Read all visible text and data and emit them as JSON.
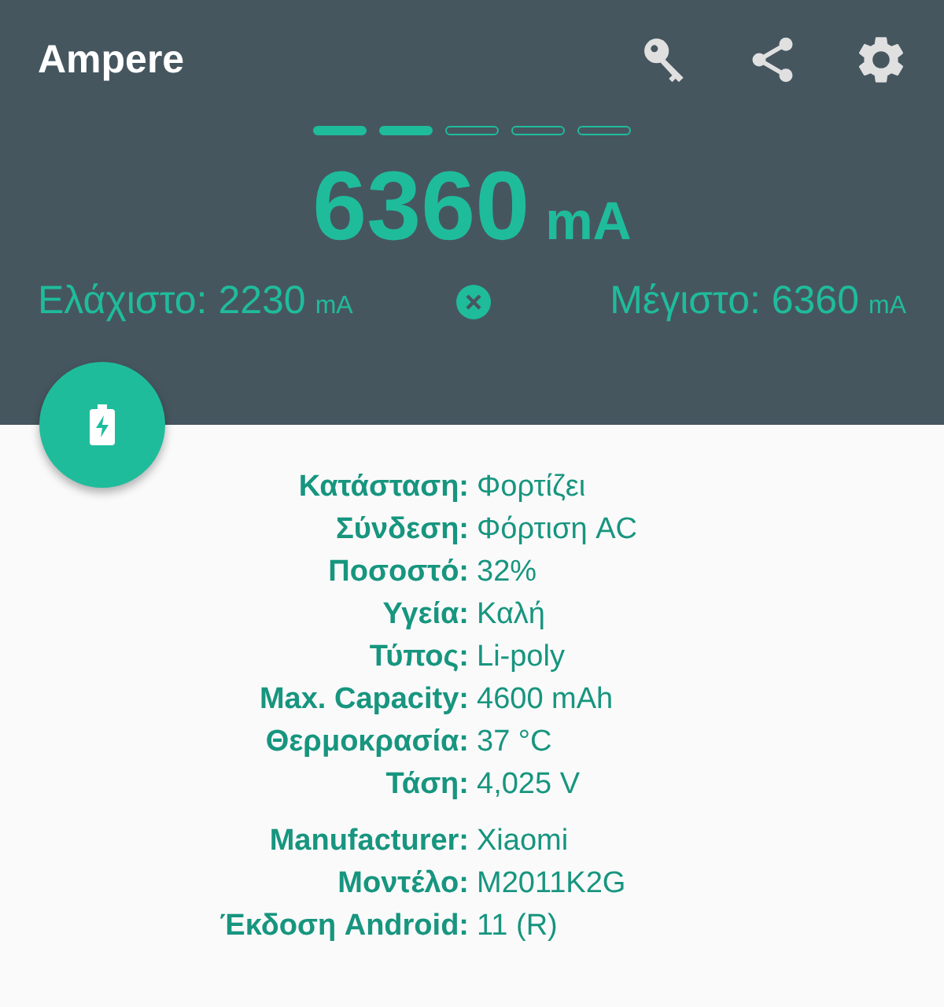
{
  "app_bar": {
    "title": "Ampere"
  },
  "indicators": [
    {
      "on": true
    },
    {
      "on": true
    },
    {
      "on": false
    },
    {
      "on": false
    },
    {
      "on": false
    }
  ],
  "current": {
    "value": "6360",
    "unit": "mA"
  },
  "min": {
    "label": "Ελάχιστο:",
    "value": "2230",
    "unit": "mA"
  },
  "max": {
    "label": "Μέγιστο:",
    "value": "6360",
    "unit": "mA"
  },
  "info_groups": [
    [
      {
        "label": "Κατάσταση:",
        "value": "Φορτίζει"
      },
      {
        "label": "Σύνδεση:",
        "value": "Φόρτιση AC"
      },
      {
        "label": "Ποσοστό:",
        "value": "32%"
      },
      {
        "label": "Υγεία:",
        "value": "Καλή"
      },
      {
        "label": "Τύπος:",
        "value": "Li-poly"
      },
      {
        "label": "Max. Capacity:",
        "value": "4600 mAh"
      },
      {
        "label": "Θερμοκρασία:",
        "value": "37 °C"
      },
      {
        "label": "Τάση:",
        "value": "4,025 V"
      }
    ],
    [
      {
        "label": "Manufacturer:",
        "value": "Xiaomi"
      },
      {
        "label": "Μοντέλο:",
        "value": "M2011K2G"
      },
      {
        "label": "Έκδοση Android:",
        "value": "11 (R)"
      }
    ]
  ]
}
